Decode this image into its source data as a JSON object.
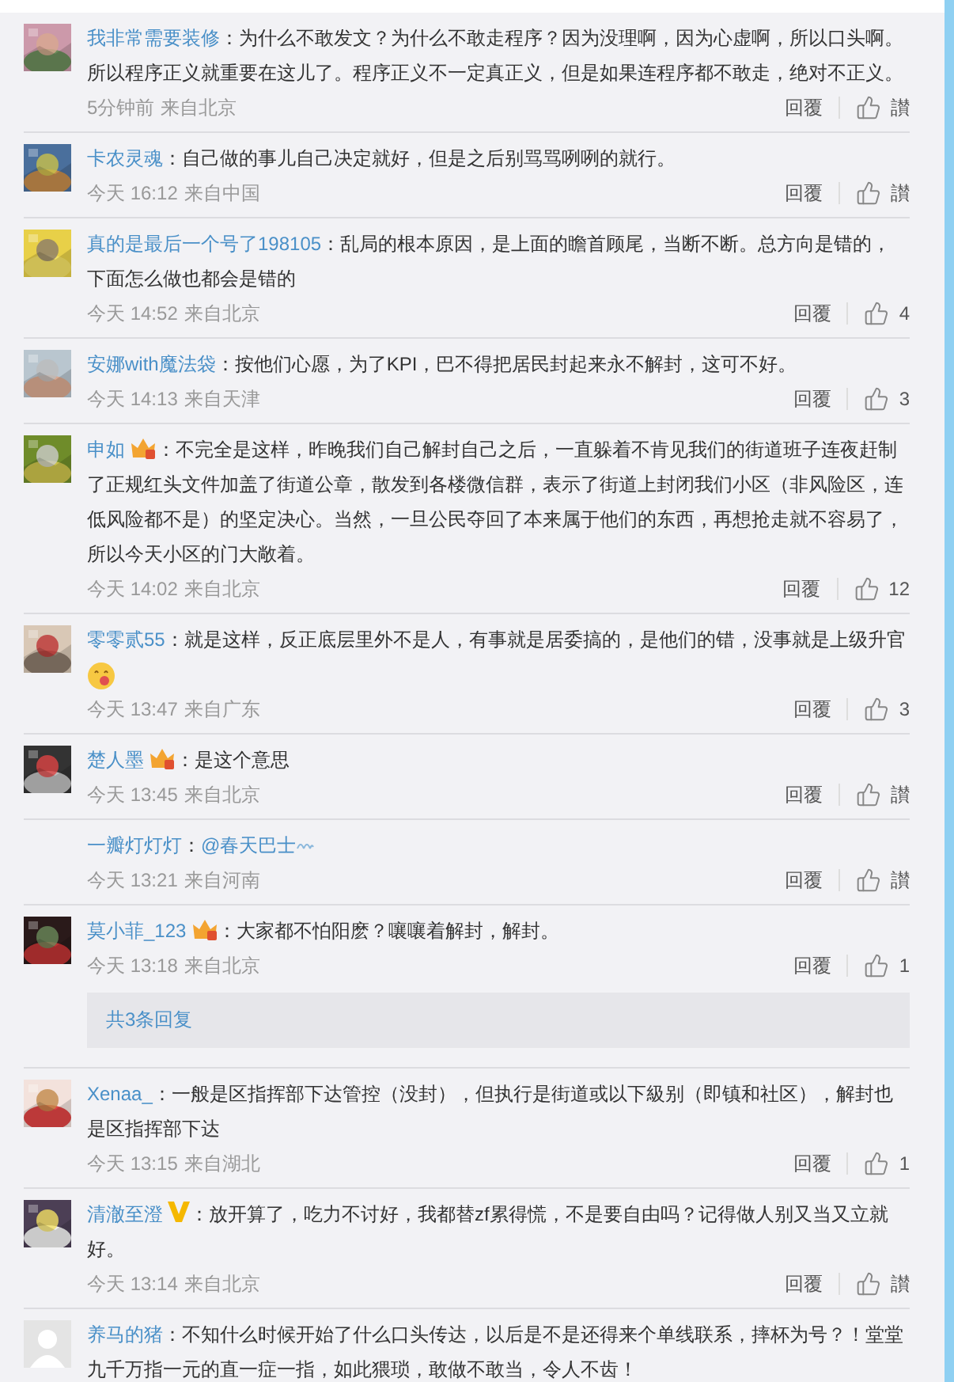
{
  "comments": [
    {
      "name": "我非常需要装修",
      "sep": "：",
      "text": "为什么不敢发文？为什么不敢走程序？因为没理啊，因为心虚啊，所以口头啊。所以程序正义就重要在这儿了。程序正义不一定真正义，但是如果连程序都不敢走，绝对不正义。",
      "time": "5分钟前",
      "location": "来自北京",
      "reply": "回覆",
      "likes": "讃"
    },
    {
      "name": "卡农灵魂",
      "sep": "：",
      "text": "自己做的事儿自己决定就好，但是之后别骂骂咧咧的就行。",
      "time": "今天 16:12",
      "location": "来自中国",
      "reply": "回覆",
      "likes": "讃"
    },
    {
      "name": "真的是最后一个号了198105",
      "sep": "：",
      "text": "乱局的根本原因，是上面的瞻首顾尾，当断不断。总方向是错的，下面怎么做也都会是错的",
      "time": "今天 14:52",
      "location": "来自北京",
      "reply": "回覆",
      "likes": "4"
    },
    {
      "name": "安娜with魔法袋",
      "sep": "：",
      "text": "按他们心愿，为了KPI，巴不得把居民封起来永不解封，这可不好。",
      "time": "今天 14:13",
      "location": "来自天津",
      "reply": "回覆",
      "likes": "3"
    },
    {
      "name": "申如",
      "badge": {
        "kind": "crown"
      },
      "sep": "：",
      "text": "不完全是这样，昨晚我们自己解封自己之后，一直躲着不肯见我们的街道班子连夜赶制了正规红头文件加盖了街道公章，散发到各楼微信群，表示了街道上封闭我们小区（非风险区，连低风险都不是）的坚定决心。当然，一旦公民夺回了本来属于他们的东西，再想抢走就不容易了，所以今天小区的门大敞着。",
      "time": "今天 14:02",
      "location": "来自北京",
      "reply": "回覆",
      "likes": "12"
    },
    {
      "name": "零零贰55",
      "sep": "：",
      "text": "就是这样，反正底层里外不是人，有事就是居委搞的，是他们的错，没事就是上级升官",
      "emoji": true,
      "time": "今天 13:47",
      "location": "来自广东",
      "reply": "回覆",
      "likes": "3"
    },
    {
      "name": "楚人墨",
      "badge": {
        "kind": "crown"
      },
      "sep": "：",
      "text": "是这个意思",
      "time": "今天 13:45",
      "location": "来自北京",
      "reply": "回覆",
      "likes": "讃"
    },
    {
      "name": "一瓣灯灯灯",
      "sep": "：",
      "mention": "@春天巴士",
      "time": "今天 13:21",
      "location": "来自河南",
      "reply": "回覆",
      "likes": "讃"
    },
    {
      "name": "莫小菲_123",
      "badge": {
        "kind": "crown"
      },
      "sep": "：",
      "text": "大家都不怕阳麽？嚷嚷着解封，解封。",
      "time": "今天 13:18",
      "location": "来自北京",
      "reply": "回覆",
      "likes": "1",
      "more_replies": "共3条回复"
    },
    {
      "name": "Xenaa_",
      "sep": "：",
      "text": "一般是区指挥部下达管控（没封），但执行是街道或以下級别（即镇和社区），解封也是区指挥部下达",
      "time": "今天 13:15",
      "location": "来自湖北",
      "reply": "回覆",
      "likes": "1"
    },
    {
      "name": "清澈至澄",
      "badge": {
        "kind": "verified"
      },
      "sep": "：",
      "text": "放开算了，吃力不讨好，我都替zf累得慌，不是要自由吗？记得做人别又当又立就好。",
      "time": "今天 13:14",
      "location": "来自北京",
      "reply": "回覆",
      "likes": "讃"
    },
    {
      "name": "养马的猪",
      "sep": "：",
      "avatar": {
        "kind": "default"
      },
      "text": "不知什么时候开始了什么口头传达，以后是不是还得来个单线联系，摔杯为号？！堂堂九千万指一元的直一症一指，如此猥琐，敢做不敢当，令人不齿！"
    }
  ]
}
